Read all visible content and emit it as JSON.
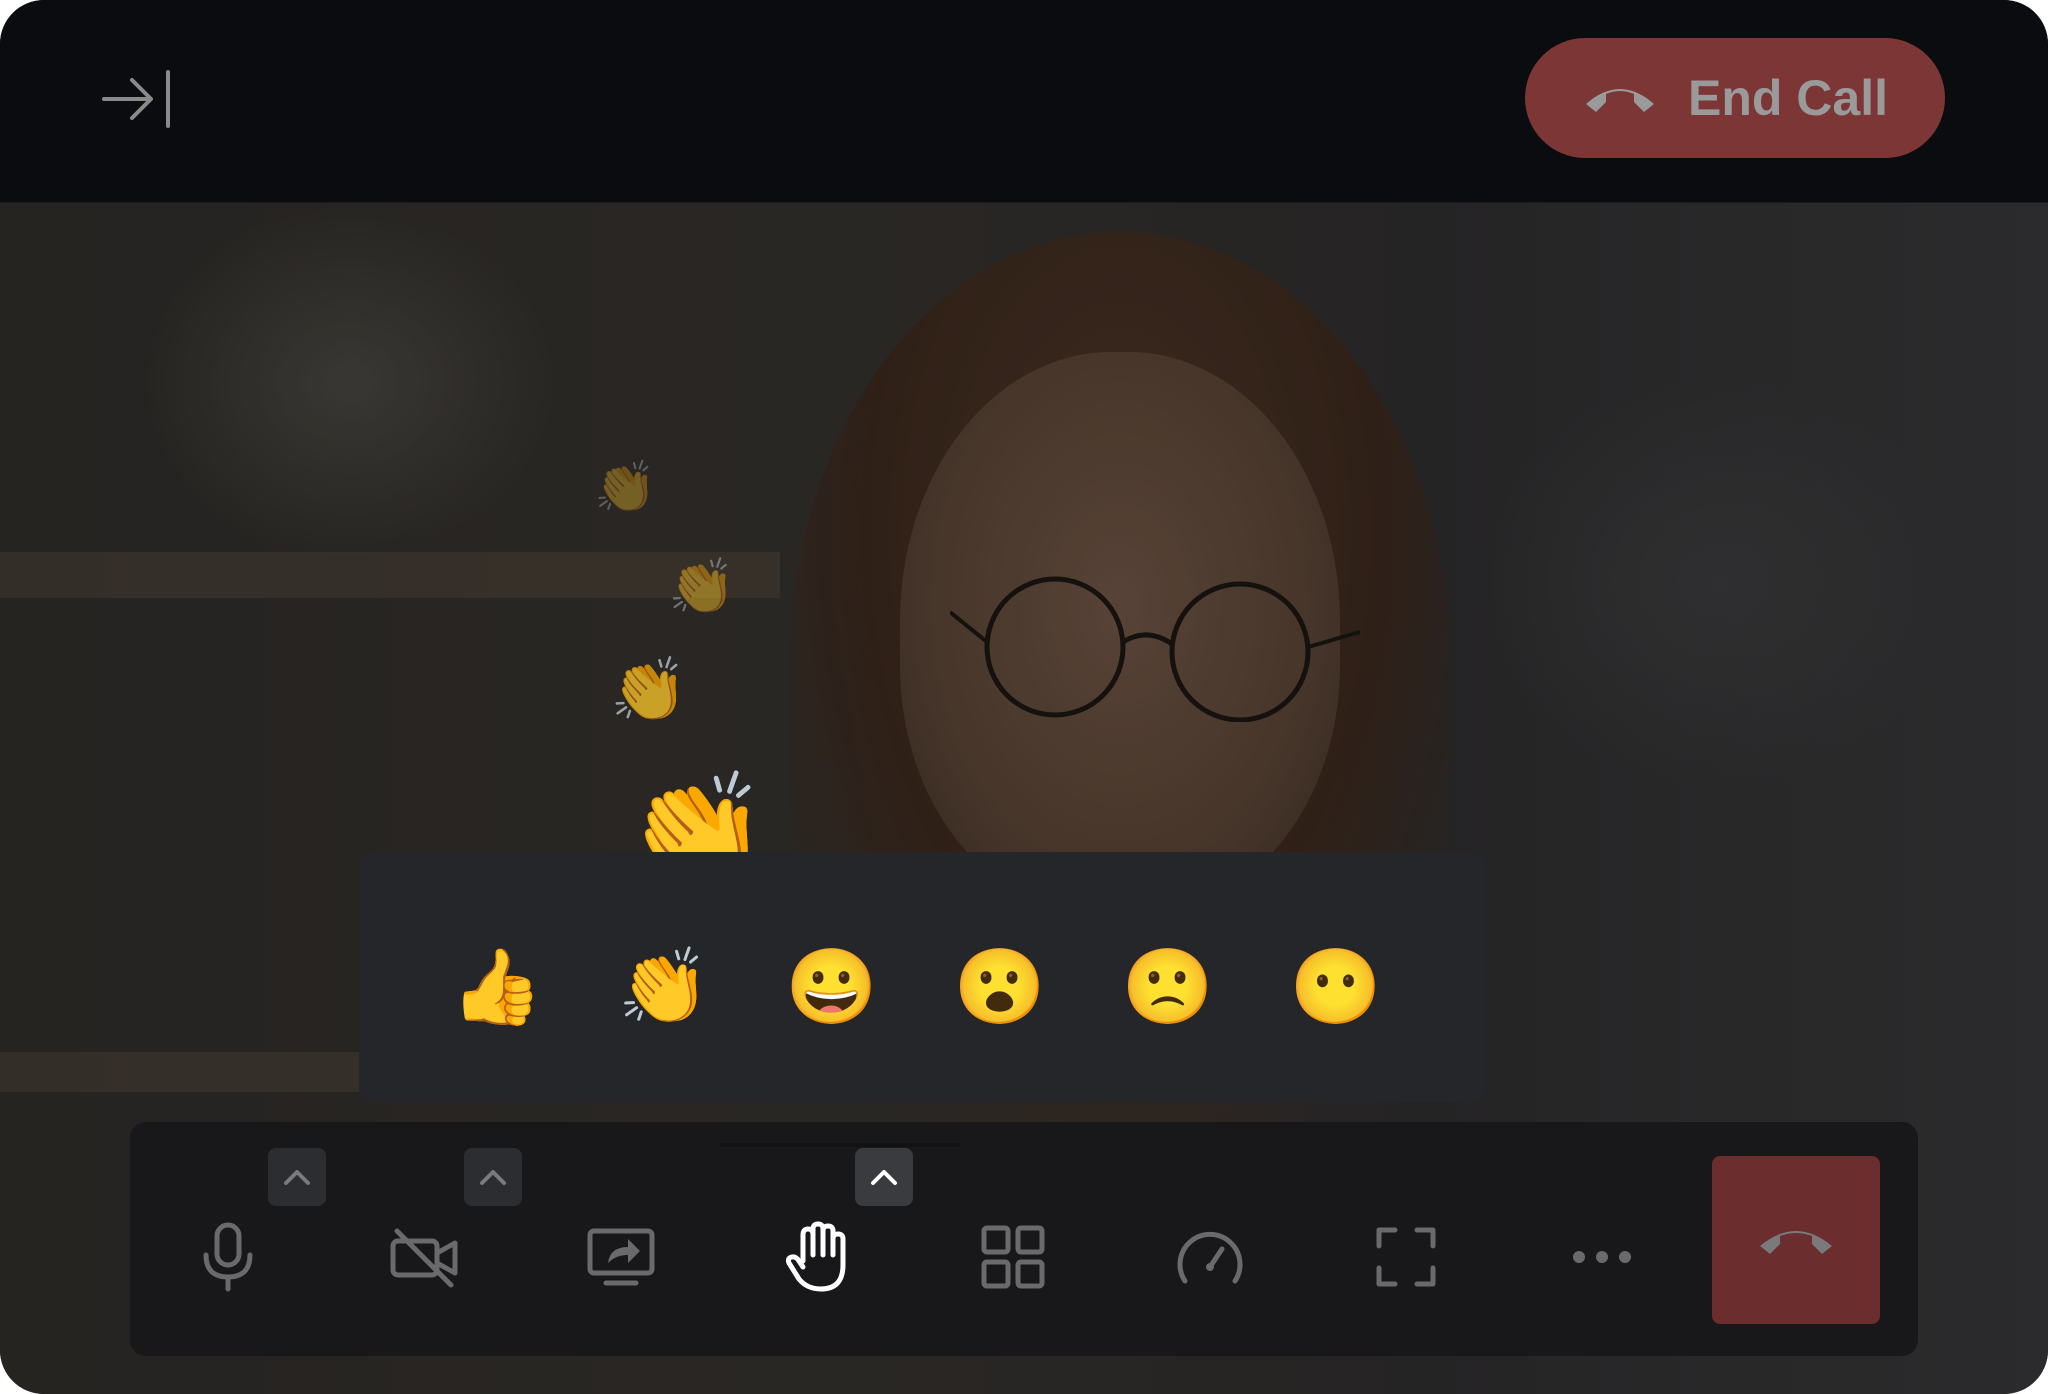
{
  "header": {
    "end_call_label": "End Call",
    "expand_icon": "arrow-right-bar-icon",
    "end_call_icon": "phone-hangup-icon"
  },
  "reactions": {
    "items": [
      {
        "emoji": "👍",
        "name": "thumbs-up"
      },
      {
        "emoji": "👏",
        "name": "clapping-hands"
      },
      {
        "emoji": "😀",
        "name": "grinning-face"
      },
      {
        "emoji": "😮",
        "name": "surprised-face"
      },
      {
        "emoji": "🙁",
        "name": "frowning-face"
      },
      {
        "emoji": "😶",
        "name": "face-without-mouth"
      }
    ],
    "floating": [
      "👏",
      "👏",
      "👏",
      "👏"
    ]
  },
  "toolbar": {
    "tools": [
      "microphone-icon",
      "camera-off-icon",
      "screen-share-icon",
      "raise-hand-icon",
      "grid-layout-icon",
      "stats-gauge-icon",
      "fullscreen-icon",
      "more-options-icon"
    ],
    "hangup_icon": "phone-hangup-icon"
  },
  "colors": {
    "end_call_bg": "#7c3636",
    "hangup_bg": "#6b2d2d",
    "panel_bg": "#25262a",
    "toolbar_bg": "#18181a"
  }
}
